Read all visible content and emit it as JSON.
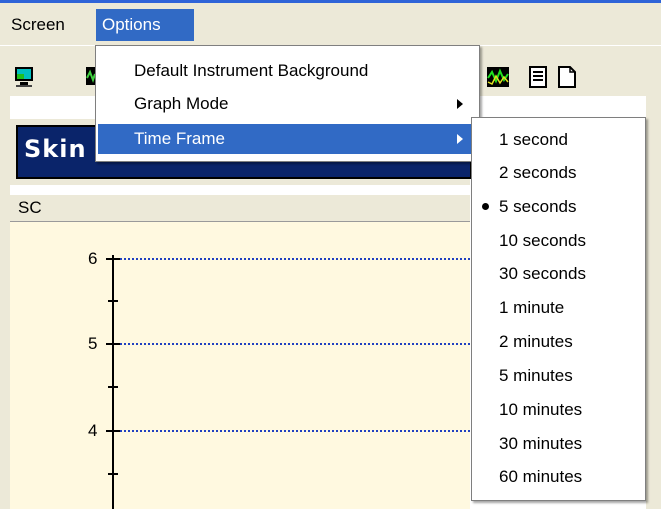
{
  "menubar": {
    "items": [
      {
        "label": "Screen"
      },
      {
        "label": "Options"
      }
    ]
  },
  "toolbar": {
    "icons": [
      "monitor-icon",
      "graph-icon",
      "waveform-icon",
      "document-icon",
      "blank-page-icon"
    ]
  },
  "title": {
    "text": "Skin"
  },
  "graph": {
    "header": "SC",
    "y_ticks": [
      "6",
      "5",
      "4"
    ]
  },
  "options_menu": {
    "items": [
      {
        "label": "Default Instrument Background",
        "has_submenu": false
      },
      {
        "label": "Graph Mode",
        "has_submenu": true
      },
      {
        "label": "Time Frame",
        "has_submenu": true,
        "highlighted": true
      }
    ]
  },
  "time_frame_menu": {
    "selected": "5 seconds",
    "items": [
      "1 second",
      "2 seconds",
      "5 seconds",
      "10 seconds",
      "30 seconds",
      "1 minute",
      "2 minutes",
      "5 minutes",
      "10 minutes",
      "30 minutes",
      "60 minutes"
    ]
  },
  "colors": {
    "highlight": "#316ac5",
    "title_bg": "#0a246a",
    "graph_bg": "#fff9e0",
    "gridline": "#2040c0"
  }
}
